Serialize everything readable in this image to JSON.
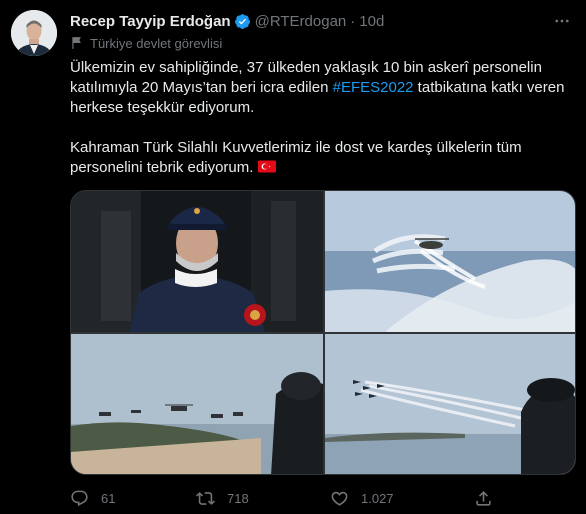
{
  "tweet": {
    "author_name": "Recep Tayyip Erdoğan",
    "handle": "@RTErdogan",
    "separator": "·",
    "time": "10d",
    "label": "Türkiye devlet görevlisi",
    "para1_a": "Ülkemizin ev sahipliğinde, 37 ülkeden yaklaşık 10 bin askerî personelin katılımıyla 20 Mayıs’tan beri icra edilen ",
    "hashtag": "#EFES2022",
    "para1_b": " tatbikatına katkı veren herkese teşekkür ediyorum.",
    "para2": "Kahraman Türk Silahlı Kuvvetlerimiz ile dost ve kardeş ülkelerin tüm personelini tebrik ediyorum.",
    "more_icon": "more-icon",
    "flag_emoji": "turkey-flag"
  },
  "media": {
    "photos": [
      {
        "subject": "man-in-military-cap-photo"
      },
      {
        "subject": "helicopter-flares-photo"
      },
      {
        "subject": "helicopters-over-coast-photo"
      },
      {
        "subject": "jet-formation-photo"
      }
    ]
  },
  "actions": {
    "reply_count": "61",
    "retweet_count": "718",
    "like_count": "1.027",
    "reply_icon": "reply-icon",
    "retweet_icon": "retweet-icon",
    "like_icon": "heart-icon",
    "share_icon": "share-icon"
  },
  "colors": {
    "background": "#000000",
    "text": "#e7e9ea",
    "muted": "#71767b",
    "link": "#1d9bf0",
    "verified": "#1d9bf0",
    "flag_red": "#e30a17"
  }
}
